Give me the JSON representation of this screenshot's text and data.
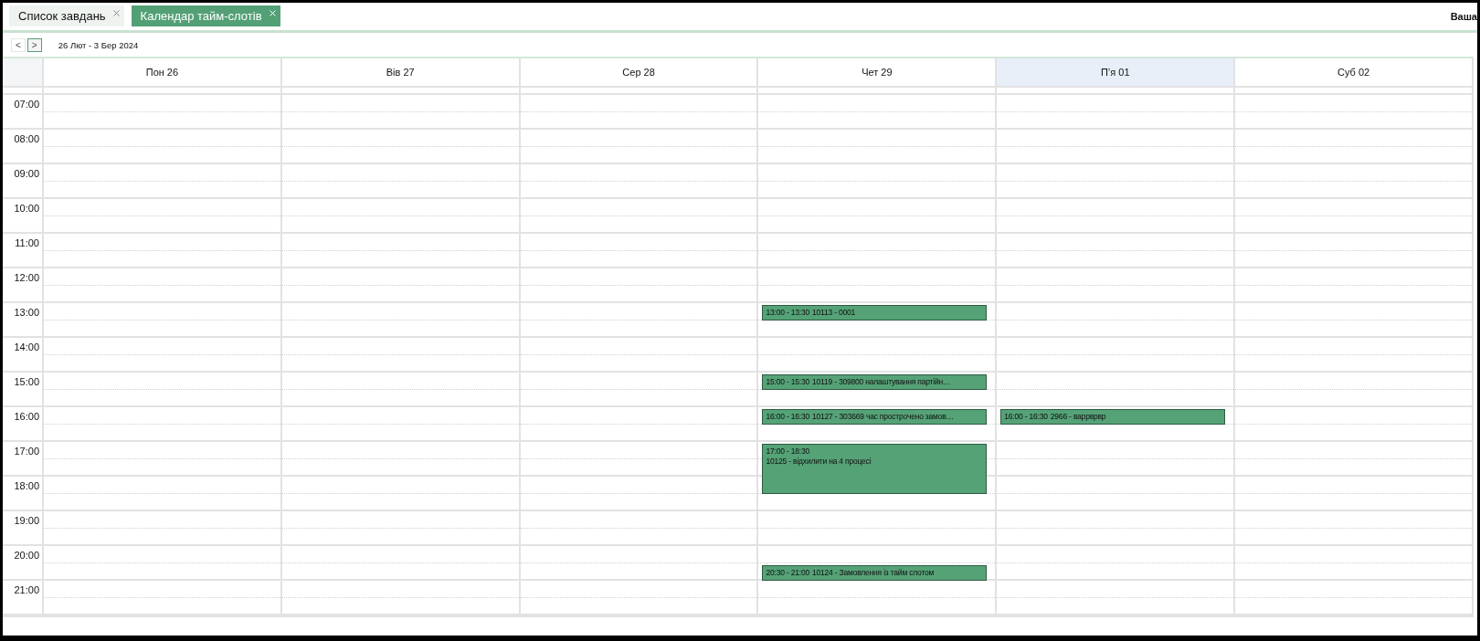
{
  "tabs": [
    {
      "label": "Список завдань",
      "selected": false
    },
    {
      "label": "Календар тайм-слотів",
      "selected": true
    }
  ],
  "user_label": "Ваша",
  "nav": {
    "prev": "<",
    "next": ">",
    "range": "26 Лют - 3 Бер 2024"
  },
  "days": [
    {
      "label": "Пон 26",
      "today": false
    },
    {
      "label": "Вів 27",
      "today": false
    },
    {
      "label": "Сер 28",
      "today": false
    },
    {
      "label": "Чет 29",
      "today": false,
      "events": [
        {
          "time": "13:00 - 13:30",
          "title": "10113 - 0001"
        },
        {
          "time": "15:00 - 15:30",
          "title": "10119 - 309800 налаштування партійн…"
        },
        {
          "time": "16:00 - 16:30",
          "title": "10127 - 303669 час прострочено замов…"
        },
        {
          "time": "17:00 - 18:30",
          "title": "10125 - відхилити на 4 процесі"
        },
        {
          "time": "20:30 - 21:00",
          "title": "10124 - Замовлення із тайм слотом"
        }
      ]
    },
    {
      "label": "П’я 01",
      "today": true,
      "events": [
        {
          "time": "16:00 - 16:30",
          "title": "2966 - варрврвр"
        }
      ]
    },
    {
      "label": "Суб 02",
      "today": false
    }
  ],
  "hours": [
    "07:00",
    "08:00",
    "09:00",
    "10:00",
    "11:00",
    "12:00",
    "13:00",
    "14:00",
    "15:00",
    "16:00",
    "17:00",
    "18:00",
    "19:00",
    "20:00",
    "21:00"
  ]
}
